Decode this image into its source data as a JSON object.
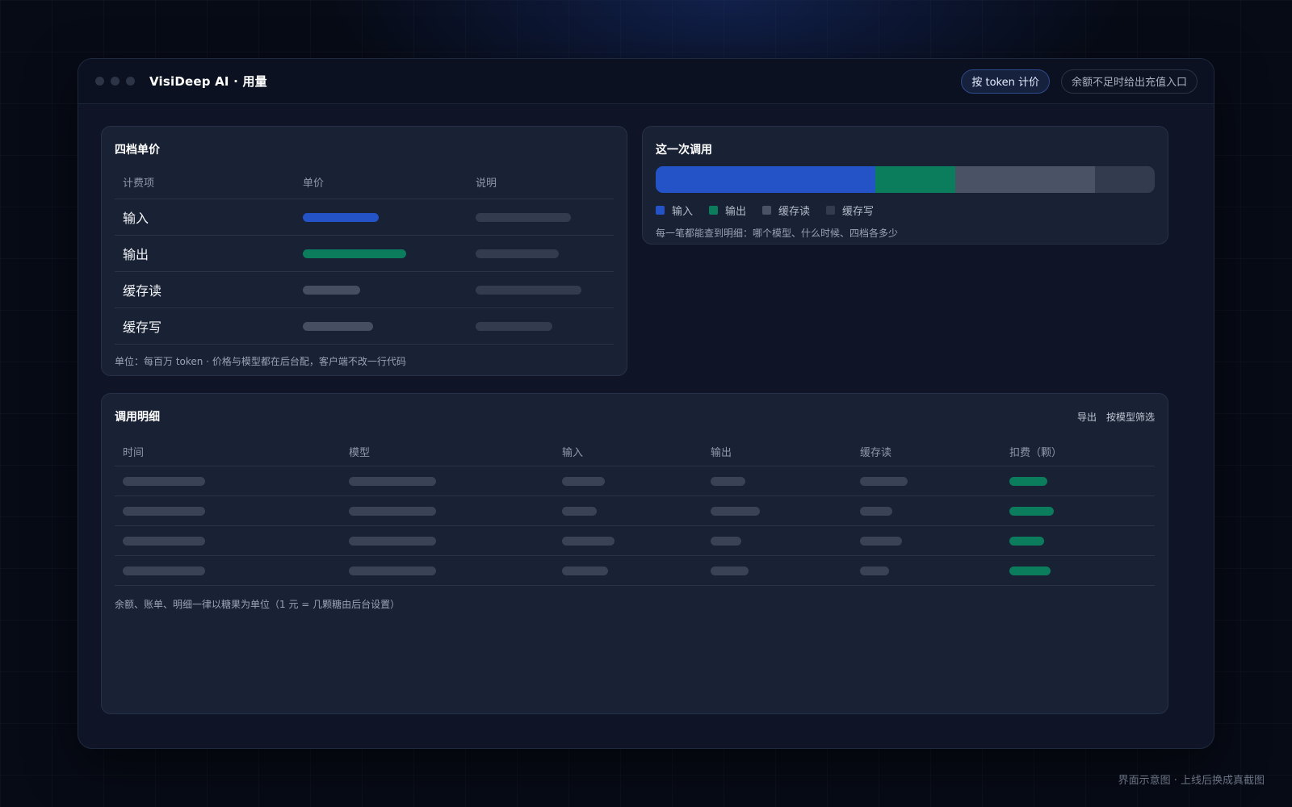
{
  "window": {
    "title": "VisiDeep AI · 用量",
    "badges": {
      "pricing_mode": "按 token 计价",
      "recharge_hint": "余额不足时给出充值入口"
    }
  },
  "pricing": {
    "title": "四档单价",
    "columns": [
      "计费项",
      "单价",
      "说明"
    ],
    "rows": [
      {
        "name": "输入",
        "price_color": "#2453c7"
      },
      {
        "name": "输出",
        "price_color": "#0b7d5c"
      },
      {
        "name": "缓存读",
        "price_color": "#464f62"
      },
      {
        "name": "缓存写",
        "price_color": "#464f62"
      }
    ],
    "note": "单位：每百万 token · 价格与模型都在后台配，客户端不改一行代码"
  },
  "call": {
    "title": "这一次调用",
    "segments": [
      {
        "label": "输入",
        "share": 0.44,
        "color": "#2453c7"
      },
      {
        "label": "输出",
        "share": 0.16,
        "color": "#0b7d5c"
      },
      {
        "label": "缓存读",
        "share": 0.28,
        "color": "#4a5366"
      },
      {
        "label": "缓存写",
        "share": 0.12,
        "color": "#333c4f"
      }
    ],
    "note": "每一笔都能查到明细：哪个模型、什么时候、四档各多少"
  },
  "detail": {
    "title": "调用明细",
    "actions": {
      "export": "导出",
      "filter": "按模型筛选"
    },
    "columns": [
      "时间",
      "模型",
      "输入",
      "输出",
      "缓存读",
      "扣费（颗）"
    ],
    "row_count": 4,
    "note": "余额、账单、明细一律以糖果为单位（1 元 = 几颗糖由后台设置）"
  },
  "caption": "界面示意图 · 上线后换成真截图",
  "colors": {
    "accent_blue": "#2453c7",
    "accent_green": "#0b7d5c",
    "placeholder": "#3a4356"
  }
}
